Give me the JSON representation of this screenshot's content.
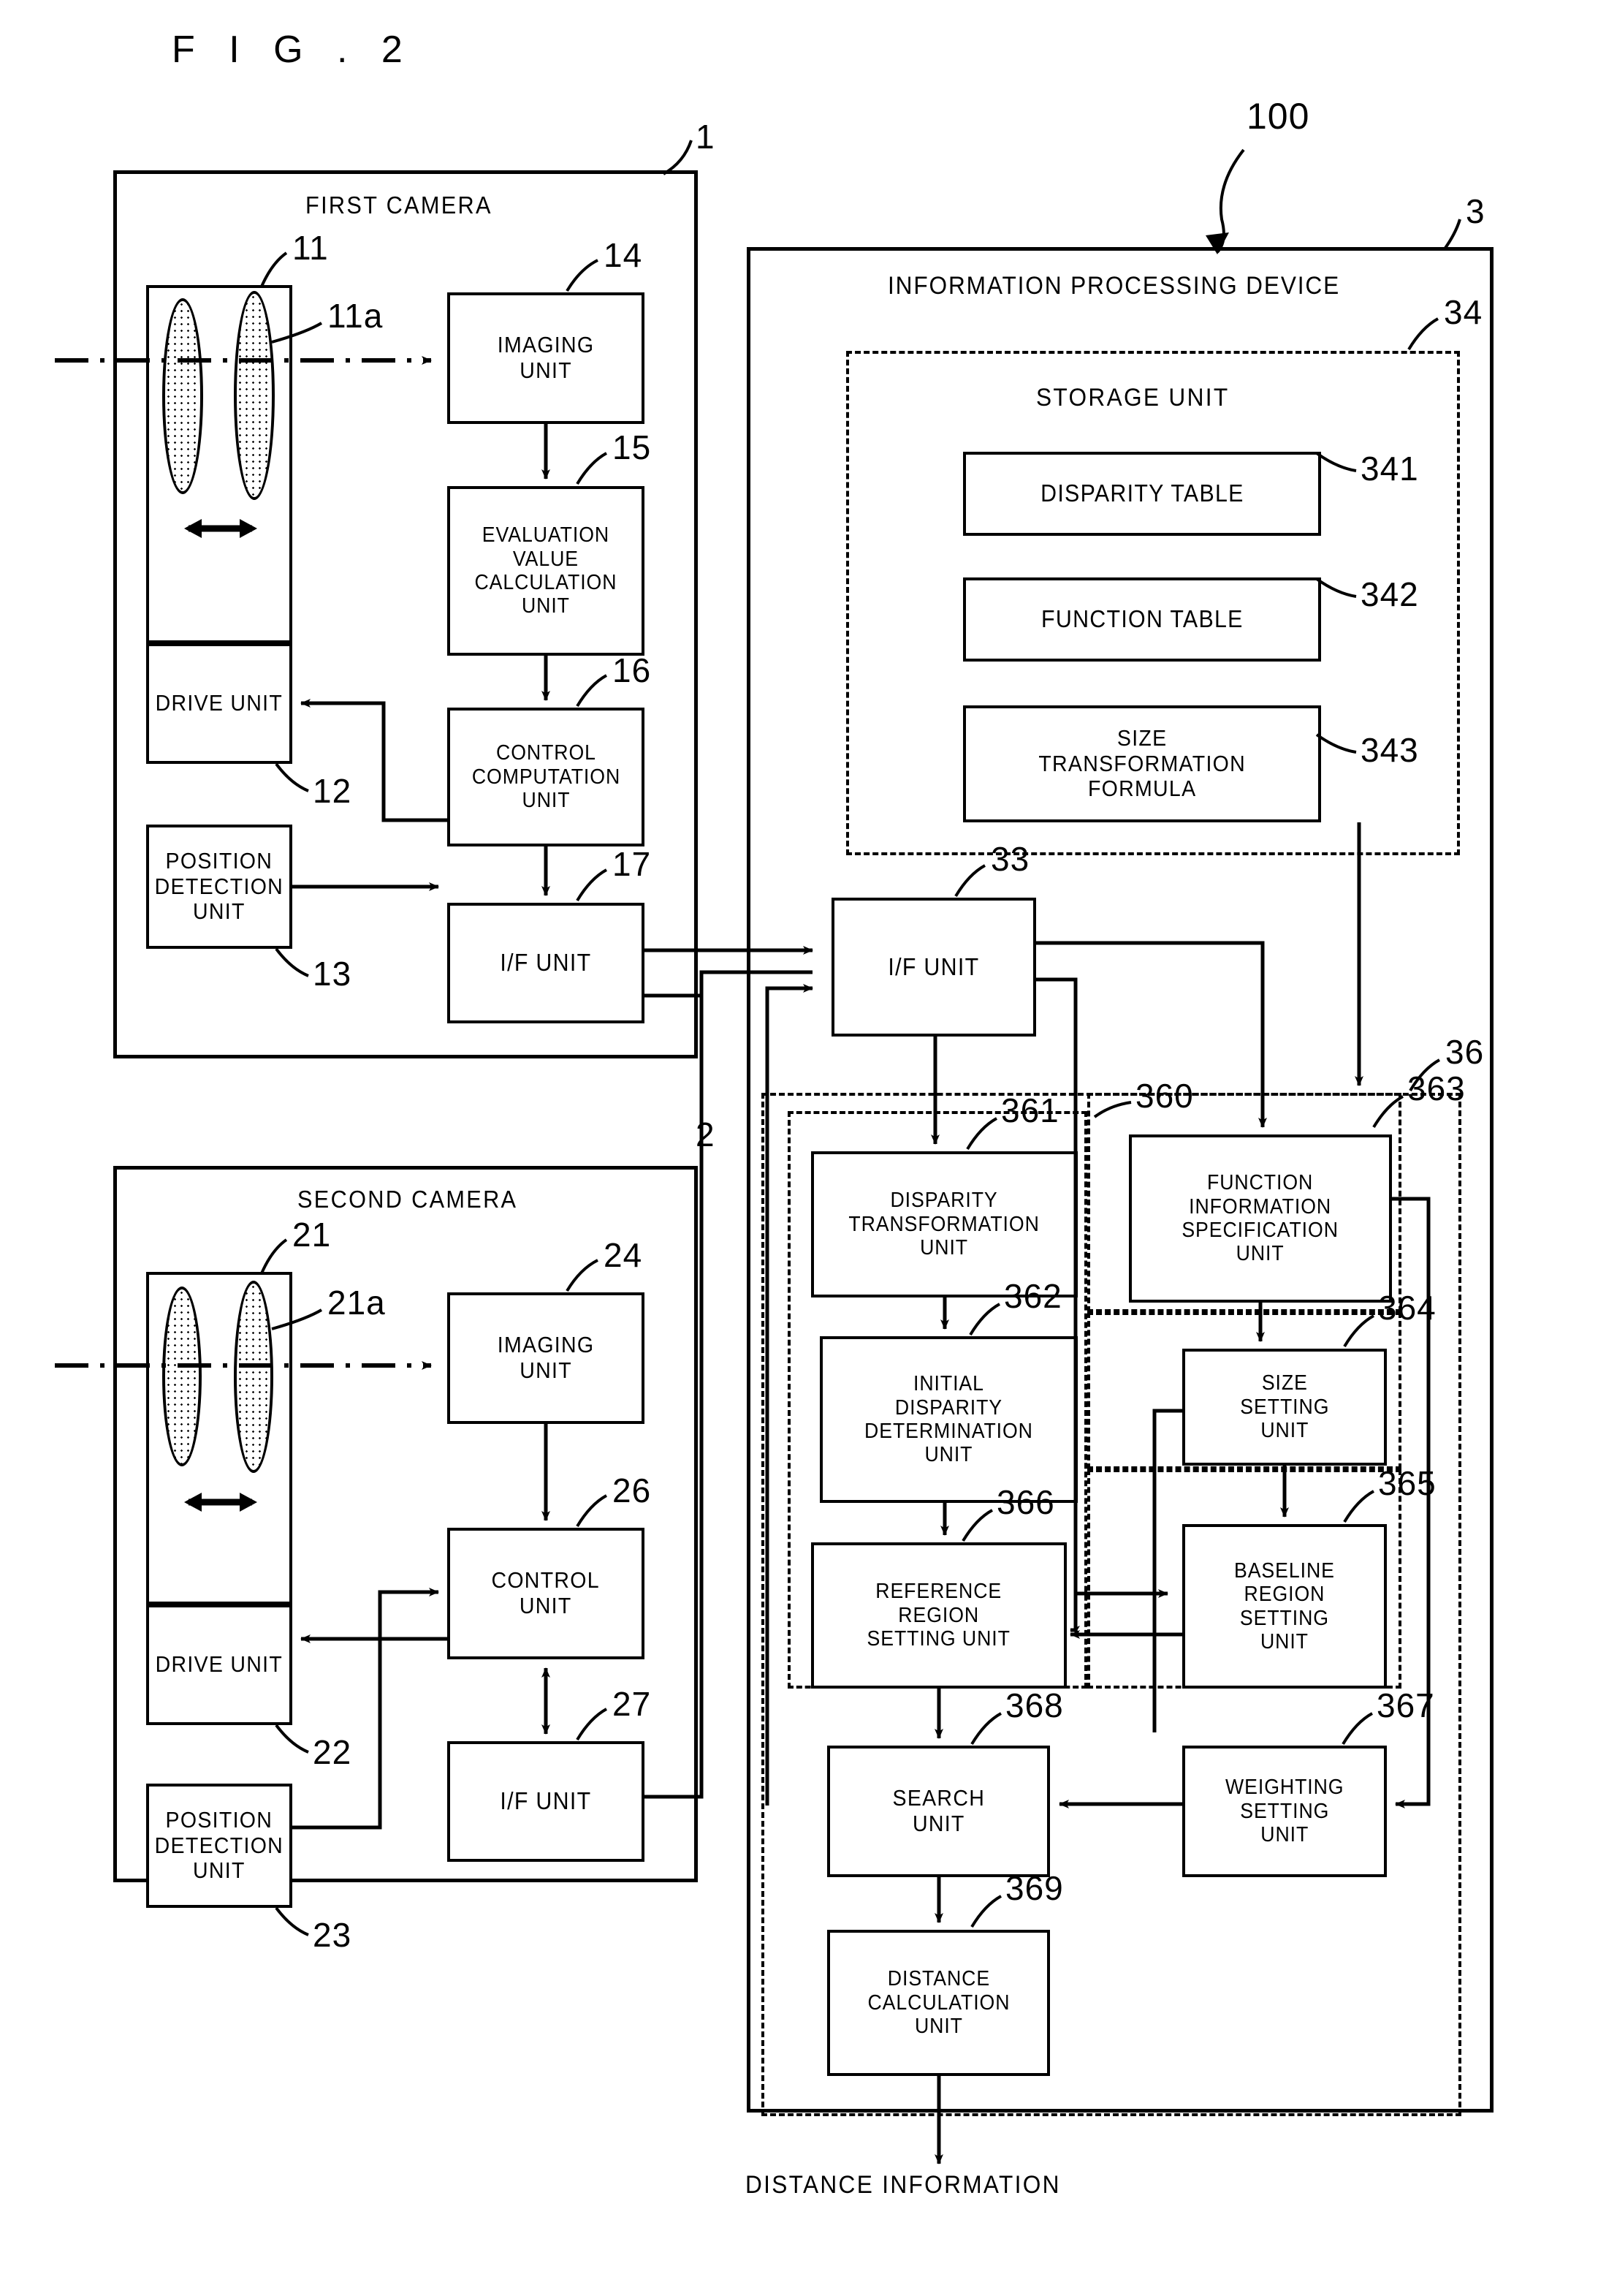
{
  "figure": {
    "title": "F I G .  2",
    "bottom_label": "DISTANCE INFORMATION"
  },
  "refs": {
    "system": "100",
    "first_camera": "1",
    "second_camera": "2",
    "info_device": "3",
    "lens_1": "11",
    "lens_1a": "11a",
    "drive_1": "12",
    "position_1": "13",
    "imaging_1": "14",
    "evaluation_1": "15",
    "control_comp_1": "16",
    "if_1": "17",
    "lens_2": "21",
    "lens_2a": "21a",
    "drive_2": "22",
    "position_2": "23",
    "imaging_2": "24",
    "control_2": "26",
    "if_2": "27",
    "if_3": "33",
    "storage": "34",
    "processing": "36",
    "disparity_table": "341",
    "function_table": "342",
    "size_formula": "343",
    "group_360": "360",
    "disparity_transform": "361",
    "initial_disparity": "362",
    "function_info": "363",
    "size_setting": "364",
    "baseline_region": "365",
    "reference_region": "366",
    "weighting": "367",
    "search": "368",
    "distance_calc": "369"
  },
  "first_camera": {
    "title": "FIRST CAMERA",
    "imaging_unit": "IMAGING\nUNIT",
    "evaluation_unit": "EVALUATION\nVALUE\nCALCULATION\nUNIT",
    "control_computation_unit": "CONTROL\nCOMPUTATION\nUNIT",
    "if_unit": "I/F UNIT",
    "drive_unit": "DRIVE UNIT",
    "position_detection_unit": "POSITION\nDETECTION\nUNIT"
  },
  "second_camera": {
    "title": "SECOND CAMERA",
    "imaging_unit": "IMAGING\nUNIT",
    "control_unit": "CONTROL\nUNIT",
    "if_unit": "I/F UNIT",
    "drive_unit": "DRIVE UNIT",
    "position_detection_unit": "POSITION\nDETECTION\nUNIT"
  },
  "info_device": {
    "title": "INFORMATION PROCESSING DEVICE",
    "storage_unit": "STORAGE UNIT",
    "disparity_table": "DISPARITY TABLE",
    "function_table": "FUNCTION TABLE",
    "size_transformation_formula": "SIZE\nTRANSFORMATION\nFORMULA",
    "if_unit": "I/F UNIT",
    "disparity_transformation_unit": "DISPARITY\nTRANSFORMATION\nUNIT",
    "initial_disparity_determination_unit": "INITIAL\nDISPARITY\nDETERMINATION\nUNIT",
    "function_information_specification_unit": "FUNCTION\nINFORMATION\nSPECIFICATION\nUNIT",
    "size_setting_unit": "SIZE\nSETTING\nUNIT",
    "baseline_region_setting_unit": "BASELINE\nREGION\nSETTING\nUNIT",
    "reference_region_setting_unit": "REFERENCE\nREGION\nSETTING UNIT",
    "weighting_setting_unit": "WEIGHTING\nSETTING\nUNIT",
    "search_unit": "SEARCH\nUNIT",
    "distance_calculation_unit": "DISTANCE\nCALCULATION\nUNIT"
  },
  "colors": {
    "line": "#000000",
    "background": "#ffffff"
  }
}
